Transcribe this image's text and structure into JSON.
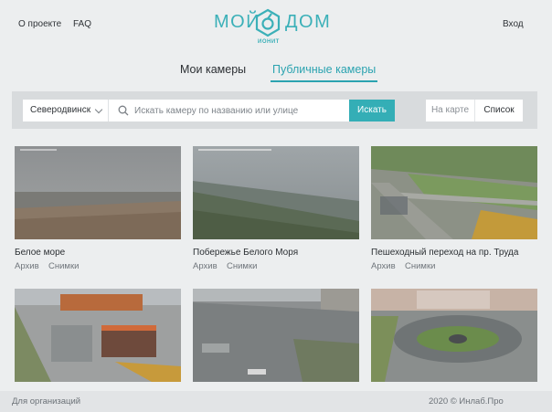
{
  "header": {
    "about_label": "О проекте",
    "faq_label": "FAQ",
    "login_label": "Вход",
    "logo_word_left": "МОЙ",
    "logo_word_right": "ДОМ",
    "logo_subtitle": "ИОНИТ",
    "brand_color": "#3bb0b8"
  },
  "tabs": [
    {
      "label": "Мои камеры",
      "active": false
    },
    {
      "label": "Публичные камеры",
      "active": true
    }
  ],
  "search": {
    "city": "Северодвинск",
    "placeholder": "Искать камеру по названию или улице",
    "value": "",
    "button_label": "Искать",
    "icon": "search-icon"
  },
  "view_switch": {
    "map_label": "На карте",
    "list_label": "Список",
    "selected": "list"
  },
  "cameras": [
    {
      "title": "Белое море",
      "archive_label": "Архив",
      "snapshots_label": "Снимки",
      "scene": "sea-beach"
    },
    {
      "title": "Побережье Белого Моря",
      "archive_label": "Архив",
      "snapshots_label": "Снимки",
      "scene": "coast-aerial"
    },
    {
      "title": "Пешеходный переход на пр. Труда",
      "archive_label": "Архив",
      "snapshots_label": "Снимки",
      "scene": "road-crossing"
    },
    {
      "title": "",
      "archive_label": "",
      "snapshots_label": "",
      "scene": "shopping-center"
    },
    {
      "title": "",
      "archive_label": "",
      "snapshots_label": "",
      "scene": "city-square"
    },
    {
      "title": "",
      "archive_label": "",
      "snapshots_label": "",
      "scene": "roundabout-square"
    }
  ],
  "footer": {
    "org_link": "Для организаций",
    "copyright": "2020 © Инлаб.Про"
  },
  "colors": {
    "accent": "#34aeb6",
    "background": "#eceeef",
    "searchbar_bg": "#d8dbdd",
    "footer_bg": "#e2e4e6"
  }
}
